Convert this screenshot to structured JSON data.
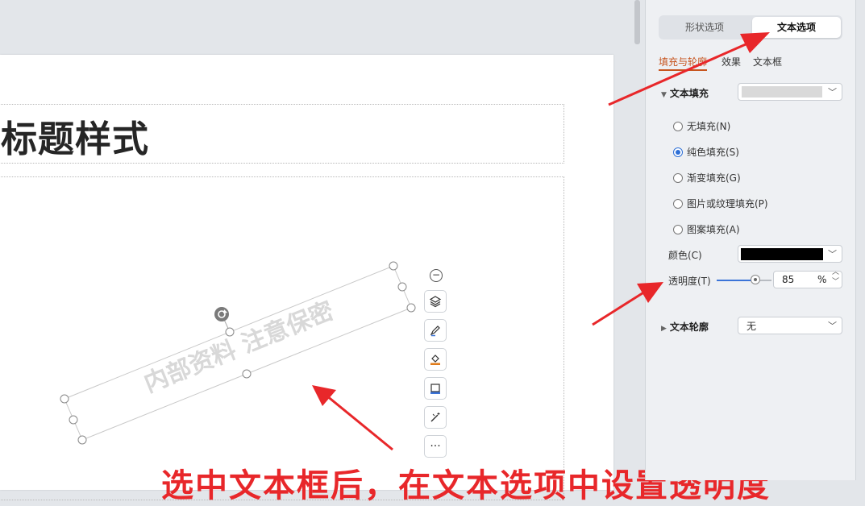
{
  "slide": {
    "title": "标题样式",
    "watermark_text": "内部资料  注意保密"
  },
  "float_toolbar": {
    "buttons": [
      "collapse-icon",
      "layers-icon",
      "pen-icon",
      "fill-bucket-icon",
      "frame-icon",
      "magic-wand-icon",
      "more-icon"
    ],
    "more_label": "···"
  },
  "annotation": {
    "text": "选中文本框后，在文本选项中设置透明度"
  },
  "panel": {
    "tabs": [
      {
        "label": "形状选项",
        "active": false
      },
      {
        "label": "文本选项",
        "active": true
      }
    ],
    "subtabs": [
      {
        "label": "填充与轮廓",
        "active": true
      },
      {
        "label": "效果",
        "active": false
      },
      {
        "label": "文本框",
        "active": false
      }
    ],
    "text_fill": {
      "label": "文本填充",
      "preview_color": "#d9d9d9",
      "options": [
        {
          "label": "无填充(N)",
          "checked": false
        },
        {
          "label": "纯色填充(S)",
          "checked": true
        },
        {
          "label": "渐变填充(G)",
          "checked": false
        },
        {
          "label": "图片或纹理填充(P)",
          "checked": false
        },
        {
          "label": "图案填充(A)",
          "checked": false
        }
      ],
      "color_label": "颜色(C)",
      "color_value": "#000000",
      "transparency_label": "透明度(T)",
      "transparency_value": "85",
      "transparency_unit": "%"
    },
    "text_outline": {
      "label": "文本轮廓",
      "value": "无"
    }
  },
  "colors": {
    "accent_blue": "#2d6fd6",
    "annotation_red": "#e8272a",
    "subtab_active": "#c7551f"
  }
}
